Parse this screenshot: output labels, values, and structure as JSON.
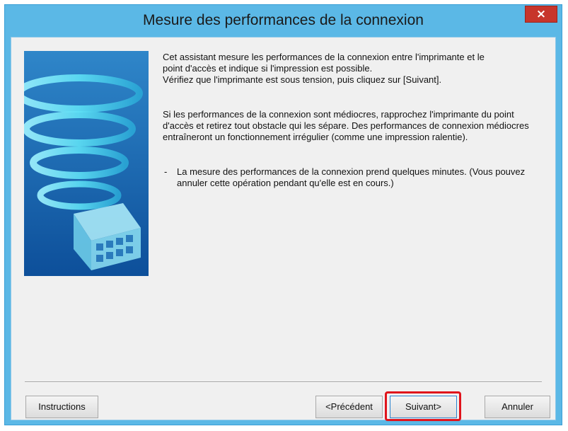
{
  "window": {
    "title": "Mesure des performances de la connexion",
    "close_label": "×"
  },
  "content": {
    "paragraph1_line1": "Cet assistant mesure les performances de la connexion entre l'imprimante et le",
    "paragraph1_line2": "point d'accès et indique si l'impression est possible.",
    "paragraph1_line3": "Vérifiez que l'imprimante est sous tension, puis cliquez sur [Suivant].",
    "paragraph2": "Si les performances de la connexion sont médiocres, rapprochez l'imprimante du point d'accès et retirez tout obstacle qui les sépare. Des performances de connexion médiocres entraîneront un fonctionnement irrégulier (comme une impression ralentie).",
    "bullet_marker": "-",
    "bullet_text": "La mesure des performances de la connexion prend quelques minutes. (Vous pouvez annuler cette opération pendant qu'elle est en cours.)"
  },
  "buttons": {
    "instructions": "Instructions",
    "previous": "<Précédent",
    "next": "Suivant>",
    "cancel": "Annuler"
  },
  "colors": {
    "titlebar": "#5bb8e6",
    "close": "#c7352b",
    "highlight": "#e0141c",
    "illustration_bg": "#1c6fb8"
  }
}
